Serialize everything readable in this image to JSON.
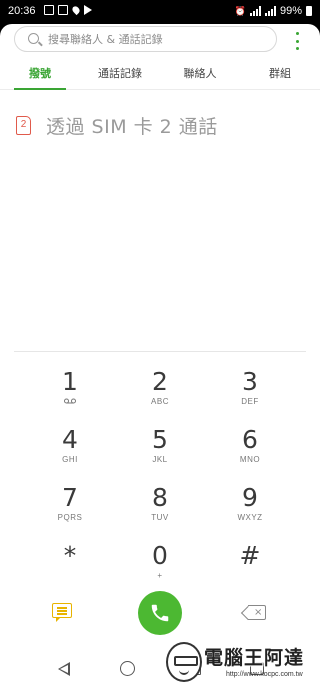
{
  "status_bar": {
    "time": "20:36",
    "battery": "99%",
    "icons": [
      "mail-icon",
      "image-icon",
      "location-icon",
      "navigation-icon",
      "alarm-icon",
      "signal-icon",
      "signal-icon",
      "battery-icon"
    ]
  },
  "search": {
    "placeholder": "搜尋聯絡人 & 通話記錄"
  },
  "tabs": [
    {
      "label": "撥號",
      "active": true
    },
    {
      "label": "通話記錄",
      "active": false
    },
    {
      "label": "聯絡人",
      "active": false
    },
    {
      "label": "群組",
      "active": false
    }
  ],
  "sim": {
    "badge": "2",
    "text": "透過 SIM 卡 2 通話"
  },
  "keypad": [
    {
      "digit": "1",
      "letters": ""
    },
    {
      "digit": "2",
      "letters": "ABC"
    },
    {
      "digit": "3",
      "letters": "DEF"
    },
    {
      "digit": "4",
      "letters": "GHI"
    },
    {
      "digit": "5",
      "letters": "JKL"
    },
    {
      "digit": "6",
      "letters": "MNO"
    },
    {
      "digit": "7",
      "letters": "PQRS"
    },
    {
      "digit": "8",
      "letters": "TUV"
    },
    {
      "digit": "9",
      "letters": "WXYZ"
    },
    {
      "digit": "*",
      "letters": ""
    },
    {
      "digit": "0",
      "letters": "+"
    },
    {
      "digit": "#",
      "letters": ""
    }
  ],
  "keypad_extra": {
    "one_letters_icon": "voicemail-icon"
  },
  "actions": {
    "message": "message-icon",
    "call": "phone-icon",
    "delete": "backspace-icon"
  },
  "colors": {
    "accent": "#3aa534",
    "call_button": "#4cb832",
    "sim_badge": "#e05a4b",
    "message_icon": "#e8b400"
  },
  "watermark": {
    "title": "電腦王阿達",
    "url": "http://www.kocpc.com.tw"
  }
}
